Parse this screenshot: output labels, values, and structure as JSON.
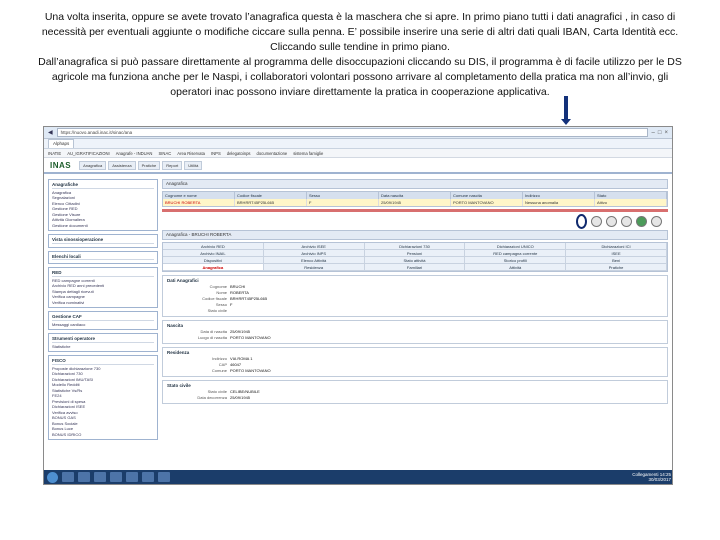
{
  "caption": {
    "line1": "Una volta inserita, oppure se avete trovato l’anagrafica questa è la maschera che si apre. In primo piano tutti i dati anagrafici , in caso di",
    "line2": "necessità per eventuali aggiunte o modifiche  ciccare sulla penna. E’ possibile inserire una serie di altri dati quali IBAN, Carta Identità ecc.",
    "line3": "Cliccando sulle tendine in primo piano.",
    "line4": "Dall’anagrafica si può passare direttamente al programma delle disoccupazioni cliccando su DIS, il programma è di facile utilizzo per le DS",
    "line5": "agricole ma funziona anche per le Naspi, i collaboratori volontari possono arrivare al completamento della pratica ma non all’invio, gli",
    "line6": "operatori inac possono inviare direttamente la pratica in cooperazione applicativa."
  },
  "browser": {
    "address": "https://nuovo.anadi.inac.it/sinac/ana",
    "tab": "Alphaps",
    "favorites": [
      "INATIE",
      "AU_IGRATIFICAZIONI",
      "Anagrafe - INDUAN",
      "SINAC",
      "Area Riservata",
      "INPS",
      "delegatoinps",
      "documentazione",
      "sistema famiglie"
    ]
  },
  "app": {
    "logo": "INAS",
    "tabs": [
      "Anagrafica",
      "Assistenza",
      "Pratiche",
      "Report",
      "Utilità"
    ]
  },
  "sidebar": {
    "box1_title": "Anagrafiche",
    "box1_items": [
      "Anagrafica",
      "Segnalazioni",
      "Elenco Cittadini",
      "Gestione RED",
      "Gestione Visure",
      "Attività Giornaliera",
      "Gestione documenti"
    ],
    "box2_title": "Vista sinossioperazione",
    "box3_title": "Elenchi locali",
    "box4_title": "RED",
    "box4_items": [
      "RED campagne correnti",
      "Archivio RED anni precedenti",
      "Stampa dettagli ricevuti",
      "Verifica campagne",
      "Verifica nominativi"
    ],
    "box5_title": "Gestione CAF",
    "box5_items": [
      "Messaggi cardiaco"
    ],
    "box6_title": "Strumenti operatore",
    "box6_items": [
      "Statistiche"
    ],
    "box7_title": "FISCO",
    "box7_items": [
      "Proposte dichiarazione 730",
      "Dichiarazioni 730",
      "Dichiarazioni IMU/TASI",
      "Modello Redditi",
      "Statistiche Vs/Rs",
      "FE24",
      "Previsioni di spesa",
      "Dichiarazioni ISEE",
      "Verifica avviso",
      "BONUS GAS",
      "Bonus Sociale",
      "Bonus Luce",
      "BONUS IDRICO"
    ]
  },
  "main": {
    "bar1": "Anagrafica",
    "grid_headers": [
      "Cognome e nome",
      "Codice fiscale",
      "Sesso",
      "Data nascita",
      "Comune nascita",
      "Indirizzo",
      "Stato"
    ],
    "grid_row": [
      "BRUCHI ROBERTA",
      "BRHRRT45P25L665",
      "F",
      "25/09/1945",
      "PORTO MANTOVANO",
      "Nessuna anomalia",
      "Attivo"
    ],
    "anag_bar": "Anagrafica - BRUCHI ROBERTA",
    "nav_tabs": [
      "Archivio RED",
      "Archivio ISEE",
      "Dichiarazioni 730",
      "Dichiarazioni UNICO",
      "Dichiarazioni ICI",
      "Archivio INAIL",
      "Archivio INPS",
      "Pensioni",
      "RED campagna corrente",
      "ISEE",
      "Dispositivi",
      "Elenco Attività",
      "Stato attività",
      "Storico profili",
      "Beni",
      "Anagrafica",
      "Residenza",
      "Familiari",
      "Attività",
      "Pratiche"
    ],
    "active_tab_index": 15,
    "dati_title": "Dati Anagrafici",
    "dati": [
      {
        "k": "Cognome",
        "v": "BRUCHI"
      },
      {
        "k": "Nome",
        "v": "ROBERTA"
      },
      {
        "k": "Codice fiscale",
        "v": "BRHRRT45P25L665"
      },
      {
        "k": "Sesso",
        "v": "F"
      },
      {
        "k": "Stato civile",
        "v": ""
      }
    ],
    "nascita_title": "Nascita",
    "nascita": [
      {
        "k": "Data di nascita",
        "v": "25/09/1945"
      },
      {
        "k": "Luogo di nascita",
        "v": "PORTO MANTOVANO"
      }
    ],
    "residenza_title": "Residenza",
    "residenza": [
      {
        "k": "Indirizzo",
        "v": "VIA ROMA 1"
      },
      {
        "k": "CAP",
        "v": "46047"
      },
      {
        "k": "Comune",
        "v": "PORTO MANTOVANO"
      }
    ],
    "stato_title": "Stato civile",
    "stato": [
      {
        "k": "Stato civile",
        "v": "CELIBE/NUBILE"
      },
      {
        "k": "Data decorrenza",
        "v": "25/09/1945"
      }
    ]
  },
  "taskbar": {
    "lang": "Collegamenti",
    "time": "14:25",
    "date": "30/03/2017"
  }
}
